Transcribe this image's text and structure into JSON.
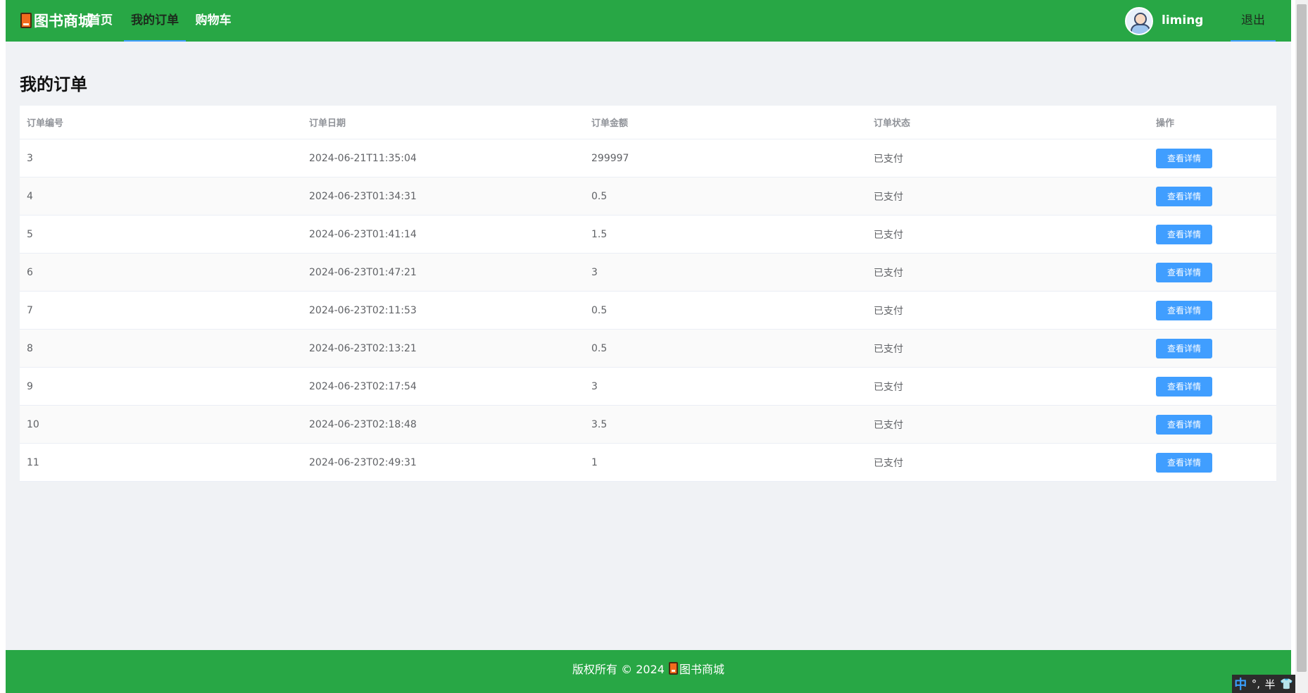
{
  "header": {
    "brand": "图书商城",
    "nav": [
      {
        "label": "首页",
        "active": false
      },
      {
        "label": "我的订单",
        "active": true
      },
      {
        "label": "购物车",
        "active": false
      }
    ],
    "username": "liming",
    "logout_label": "退出"
  },
  "page_title": "我的订单",
  "table": {
    "columns": [
      "订单编号",
      "订单日期",
      "订单金额",
      "订单状态",
      "操作"
    ],
    "rows": [
      {
        "id": "3",
        "date": "2024-06-21T11:35:04",
        "amount": "299997",
        "status": "已支付",
        "action": "查看详情"
      },
      {
        "id": "4",
        "date": "2024-06-23T01:34:31",
        "amount": "0.5",
        "status": "已支付",
        "action": "查看详情"
      },
      {
        "id": "5",
        "date": "2024-06-23T01:41:14",
        "amount": "1.5",
        "status": "已支付",
        "action": "查看详情"
      },
      {
        "id": "6",
        "date": "2024-06-23T01:47:21",
        "amount": "3",
        "status": "已支付",
        "action": "查看详情"
      },
      {
        "id": "7",
        "date": "2024-06-23T02:11:53",
        "amount": "0.5",
        "status": "已支付",
        "action": "查看详情"
      },
      {
        "id": "8",
        "date": "2024-06-23T02:13:21",
        "amount": "0.5",
        "status": "已支付",
        "action": "查看详情"
      },
      {
        "id": "9",
        "date": "2024-06-23T02:17:54",
        "amount": "3",
        "status": "已支付",
        "action": "查看详情"
      },
      {
        "id": "10",
        "date": "2024-06-23T02:18:48",
        "amount": "3.5",
        "status": "已支付",
        "action": "查看详情"
      },
      {
        "id": "11",
        "date": "2024-06-23T02:49:31",
        "amount": "1",
        "status": "已支付",
        "action": "查看详情"
      }
    ]
  },
  "footer": {
    "copyright": "版权所有 © 2024",
    "brand": "图书商城"
  },
  "ime": {
    "mode": "中",
    "punct": "°,",
    "width": "半"
  },
  "colors": {
    "header_bg": "#28a745",
    "accent": "#409eff",
    "page_bg": "#f0f2f5"
  }
}
